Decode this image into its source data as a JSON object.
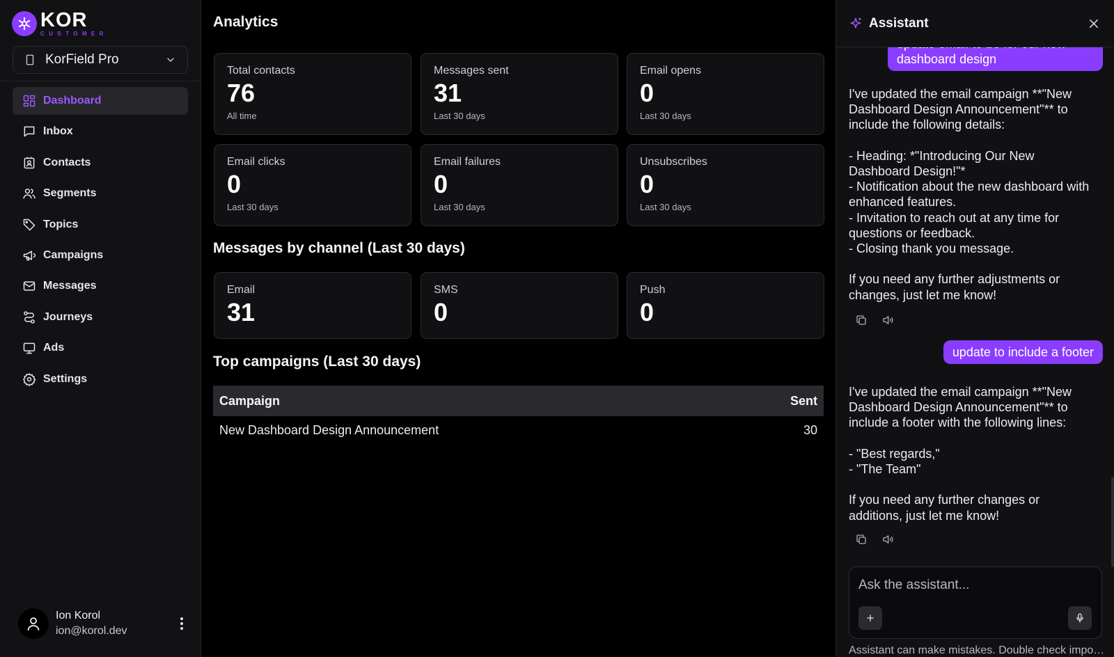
{
  "brand": {
    "name": "KOR",
    "sub": "CUSTOMER",
    "accent": "#8b3dff"
  },
  "workspace": {
    "label": "KorField Pro"
  },
  "nav": [
    {
      "label": "Dashboard",
      "icon": "dashboard-icon",
      "active": true
    },
    {
      "label": "Inbox",
      "icon": "inbox-icon"
    },
    {
      "label": "Contacts",
      "icon": "contacts-icon"
    },
    {
      "label": "Segments",
      "icon": "segments-icon"
    },
    {
      "label": "Topics",
      "icon": "tag-icon"
    },
    {
      "label": "Campaigns",
      "icon": "megaphone-icon"
    },
    {
      "label": "Messages",
      "icon": "mail-icon"
    },
    {
      "label": "Journeys",
      "icon": "journey-icon"
    },
    {
      "label": "Ads",
      "icon": "monitor-icon"
    },
    {
      "label": "Settings",
      "icon": "gear-icon"
    }
  ],
  "user": {
    "name": "Ion Korol",
    "email": "ion@korol.dev"
  },
  "main": {
    "title": "Analytics",
    "stats": [
      {
        "label": "Total contacts",
        "value": "76",
        "sub": "All time"
      },
      {
        "label": "Messages sent",
        "value": "31",
        "sub": "Last 30 days"
      },
      {
        "label": "Email opens",
        "value": "0",
        "sub": "Last 30 days"
      },
      {
        "label": "Email clicks",
        "value": "0",
        "sub": "Last 30 days"
      },
      {
        "label": "Email failures",
        "value": "0",
        "sub": "Last 30 days"
      },
      {
        "label": "Unsubscribes",
        "value": "0",
        "sub": "Last 30 days"
      }
    ],
    "channels_title": "Messages by channel (Last 30 days)",
    "channels": [
      {
        "label": "Email",
        "value": "31"
      },
      {
        "label": "SMS",
        "value": "0"
      },
      {
        "label": "Push",
        "value": "0"
      }
    ],
    "campaigns_title": "Top campaigns (Last 30 days)",
    "table": {
      "headers": [
        "Campaign",
        "Sent"
      ],
      "rows": [
        [
          "New Dashboard Design Announcement",
          "30"
        ]
      ]
    }
  },
  "assistant": {
    "title": "Assistant",
    "messages": [
      {
        "role": "user",
        "text": "update email to be for our new dashboard design"
      },
      {
        "role": "assistant",
        "text": "I've updated the email campaign **\"New Dashboard Design Announcement\"** to include the following details:\n\n- Heading: *\"Introducing Our New Dashboard Design!\"*\n- Notification about the new dashboard with enhanced features.\n- Invitation to reach out at any time for questions or feedback.\n- Closing thank you message.\n\nIf you need any further adjustments or changes, just let me know!"
      },
      {
        "role": "user",
        "text": "update to include a footer"
      },
      {
        "role": "assistant",
        "text": "I've updated the email campaign **\"New Dashboard Design Announcement\"** to include a footer with the following lines:\n\n- \"Best regards,\"\n- \"The Team\"\n\nIf you need any further changes or additions, just let me know!"
      }
    ],
    "input_placeholder": "Ask the assistant...",
    "disclaimer": "Assistant can make mistakes. Double check important info."
  }
}
